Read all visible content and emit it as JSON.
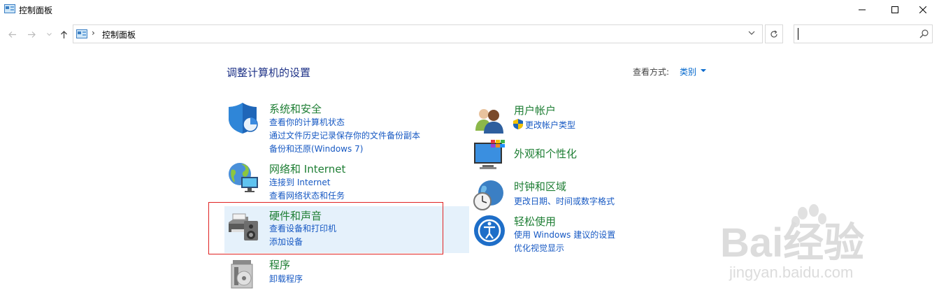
{
  "window": {
    "title": "控制面板"
  },
  "address": {
    "crumb": "控制面板",
    "search_value": ""
  },
  "main": {
    "heading": "调整计算机的设置",
    "view_by_label": "查看方式:",
    "view_by_value": "类别",
    "categories": [
      {
        "title": "系统和安全",
        "links": [
          "查看你的计算机状态",
          "通过文件历史记录保存你的文件备份副本",
          "备份和还原(Windows 7)"
        ]
      },
      {
        "title": "网络和 Internet",
        "links": [
          "连接到 Internet",
          "查看网络状态和任务"
        ]
      },
      {
        "title": "硬件和声音",
        "links": [
          "查看设备和打印机",
          "添加设备"
        ]
      },
      {
        "title": "程序",
        "links": [
          "卸载程序"
        ]
      },
      {
        "title": "用户帐户",
        "links": [
          "更改帐户类型"
        ]
      },
      {
        "title": "外观和个性化",
        "links": []
      },
      {
        "title": "时钟和区域",
        "links": [
          "更改日期、时间或数字格式"
        ]
      },
      {
        "title": "轻松使用",
        "links": [
          "使用 Windows 建议的设置",
          "优化视觉显示"
        ]
      }
    ]
  },
  "watermark": {
    "text": "Bai经验",
    "url": "jingyan.baidu.com"
  }
}
